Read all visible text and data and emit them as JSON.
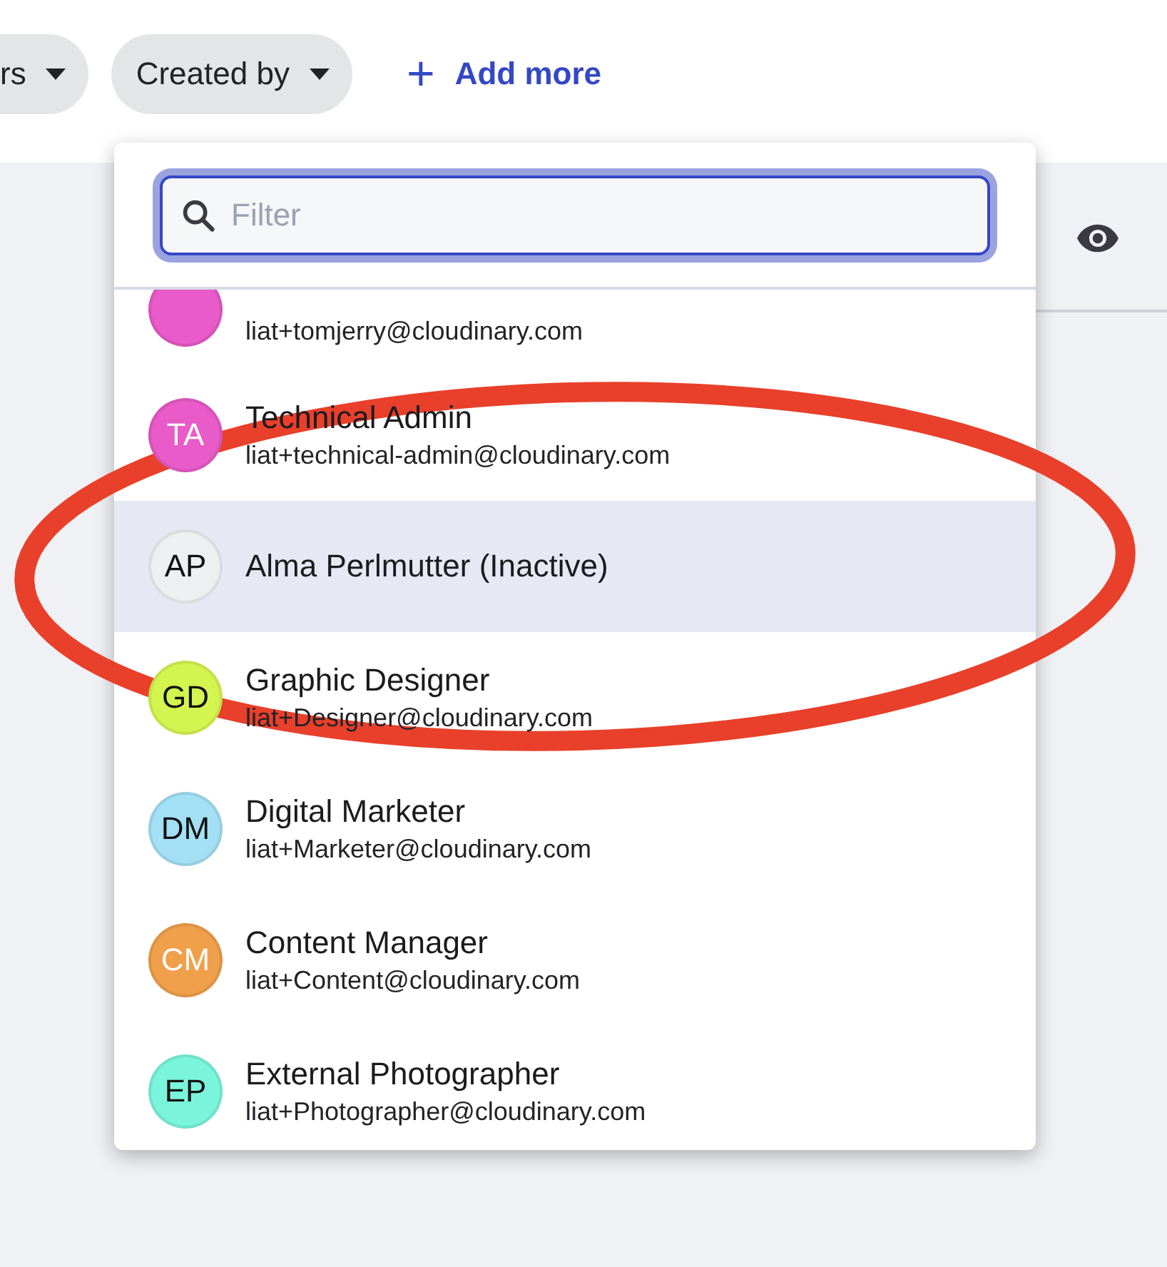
{
  "filters": [
    {
      "label": "rs"
    },
    {
      "label": "Created by"
    }
  ],
  "add_more": {
    "icon": "+",
    "label": "Add more"
  },
  "dropdown": {
    "search": {
      "placeholder": "Filter"
    },
    "users": [
      {
        "email": "liat+tomjerry@cloudinary.com",
        "color": "#e85bc8",
        "clipped": true
      },
      {
        "initials": "TA",
        "name": "Technical Admin",
        "email": "liat+technical-admin@cloudinary.com",
        "color": "#e85bc8",
        "selected": false
      },
      {
        "initials": "AP",
        "name": "Alma Perlmutter (Inactive)",
        "color": "#eeeff1",
        "selected": true
      },
      {
        "initials": "GD",
        "name": "Graphic Designer",
        "email": "liat+Designer@cloudinary.com",
        "color": "#d4f54f",
        "selected": false
      },
      {
        "initials": "DM",
        "name": "Digital Marketer",
        "email": "liat+Marketer@cloudinary.com",
        "color": "#a3e0f5",
        "selected": false
      },
      {
        "initials": "CM",
        "name": "Content Manager",
        "email": "liat+Content@cloudinary.com",
        "color": "#f0a04b",
        "selected": false
      },
      {
        "initials": "EP",
        "name": "External Photographer",
        "email": "liat+Photographer@cloudinary.com",
        "color": "#7af5dc",
        "selected": false
      }
    ]
  }
}
